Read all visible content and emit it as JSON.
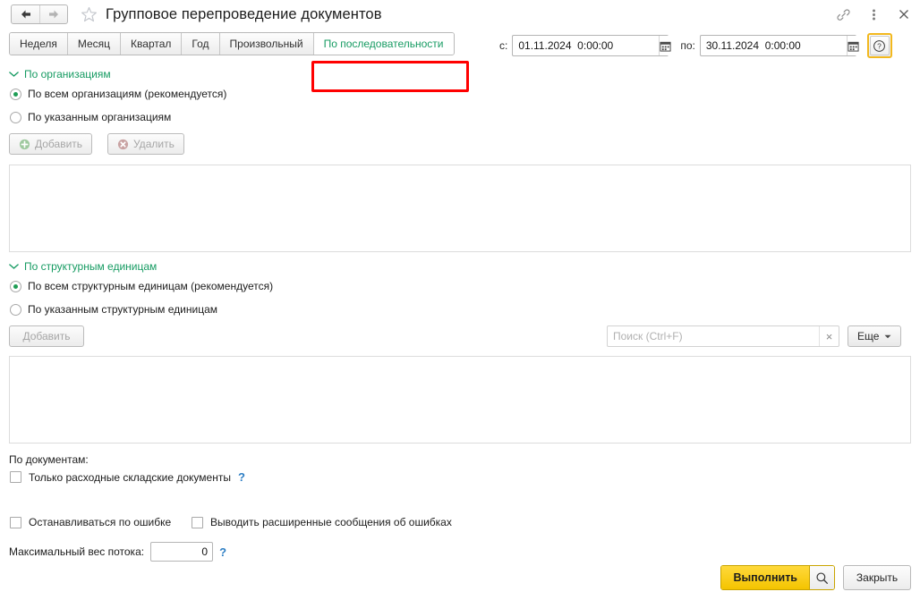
{
  "window": {
    "title": "Групповое перепроведение документов",
    "nav": {
      "back": "back-arrow",
      "forward": "forward-arrow"
    },
    "icons": {
      "favorite": "star-icon",
      "link": "link-icon",
      "menu": "kebab-menu-icon",
      "close": "close-icon"
    }
  },
  "period": {
    "tabs": [
      {
        "label": "Неделя",
        "active": false
      },
      {
        "label": "Месяц",
        "active": false
      },
      {
        "label": "Квартал",
        "active": false
      },
      {
        "label": "Год",
        "active": false
      },
      {
        "label": "Произвольный",
        "active": false
      },
      {
        "label": "По последовательности",
        "active": true
      }
    ],
    "from_label": "с:",
    "from_value": "01.11.2024  0:00:00",
    "to_label": "по:",
    "to_value": "30.11.2024  0:00:00",
    "help_glyph": "?"
  },
  "organizations": {
    "header": "По организациям",
    "option_all": "По всем организациям (рекомендуется)",
    "option_specified": "По указанным организациям",
    "selected": "all",
    "add_button": "Добавить",
    "delete_button": "Удалить"
  },
  "structural_units": {
    "header": "По структурным единицам",
    "option_all": "По всем структурным единицам (рекомендуется)",
    "option_specified": "По указанным структурным единицам",
    "selected": "all",
    "add_button": "Добавить",
    "search_placeholder": "Поиск (Ctrl+F)",
    "search_value": "",
    "clear_glyph": "×",
    "more_button": "Еще"
  },
  "documents": {
    "label": "По документам:",
    "only_expense_checkbox": "Только расходные складские документы",
    "only_expense_checked": false,
    "help_glyph": "?"
  },
  "errors": {
    "stop_on_error": "Останавливаться по ошибке",
    "stop_on_error_checked": false,
    "extended_messages": "Выводить расширенные сообщения об ошибках",
    "extended_messages_checked": false
  },
  "stream": {
    "label": "Максимальный вес потока:",
    "value": "0",
    "help_glyph": "?"
  },
  "footer": {
    "execute_button": "Выполнить",
    "execute_icon": "magnifier-icon",
    "close_button": "Закрыть"
  },
  "colors": {
    "accent_green": "#169b62",
    "execute_yellow": "#f4c400",
    "highlight_red": "#ff0000",
    "focus_orange": "#f2b81e",
    "help_blue": "#2e7fc4"
  }
}
